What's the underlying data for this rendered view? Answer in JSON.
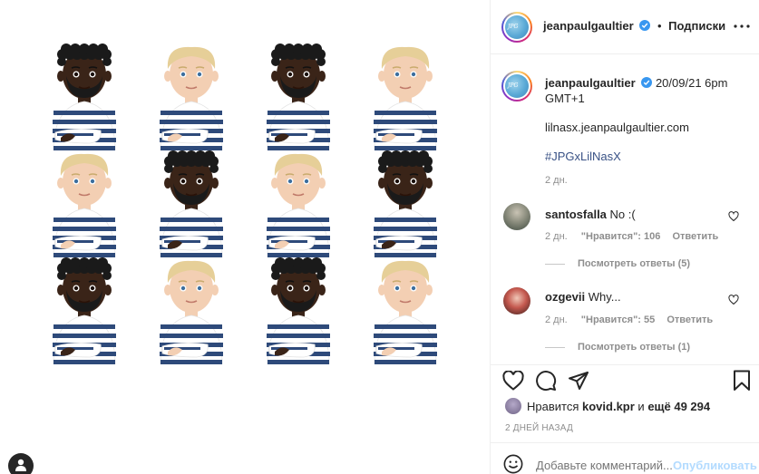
{
  "post": {
    "author": "jeanpaulgaultier",
    "follow_label": "Подписки",
    "separator": "•",
    "avatar_text": "JPG"
  },
  "caption": {
    "author": "jeanpaulgaultier",
    "date_line": "20/09/21 6pm",
    "tz_line": "GMT+1",
    "url": "lilnasx.jeanpaulgaultier.com",
    "hashtag": "#JPGxLilNasX",
    "age": "2 дн."
  },
  "comments": [
    {
      "user": "santosfalla",
      "text": "No :(",
      "age": "2 дн.",
      "likes": "\"Нравится\": 106",
      "reply_label": "Ответить",
      "view_replies": "Посмотреть ответы (5)"
    },
    {
      "user": "ozgevii",
      "text": "Why...",
      "age": "2 дн.",
      "likes": "\"Нравится\": 55",
      "reply_label": "Ответить",
      "view_replies": "Посмотреть ответы (1)"
    }
  ],
  "likes": {
    "prefix": "Нравится",
    "user": "kovid.kpr",
    "conj": "и",
    "others": "ещё 49 294"
  },
  "post_date": "2 ДНЕЙ НАЗАД",
  "comment_box": {
    "placeholder": "Добавьте комментарий...",
    "publish_label": "Опубликовать"
  },
  "icons": {
    "like": "heart-icon",
    "comment": "comment-bubble-icon",
    "share": "paper-plane-icon",
    "save": "bookmark-icon",
    "more": "more-dots-icon",
    "emoji": "emoji-smile-icon",
    "verified": "verified-badge-icon",
    "user_tag": "user-tag-icon"
  },
  "colors": {
    "verified": "#3897f0",
    "link": "#385185",
    "secondary_text": "#8e8e8e",
    "publish_disabled": "#b3dbff",
    "stripe_navy": "#2e4a7a",
    "dark_skin": "#3a2418",
    "light_skin": "#f3cfb3",
    "blond_hair": "#e6cf98"
  }
}
